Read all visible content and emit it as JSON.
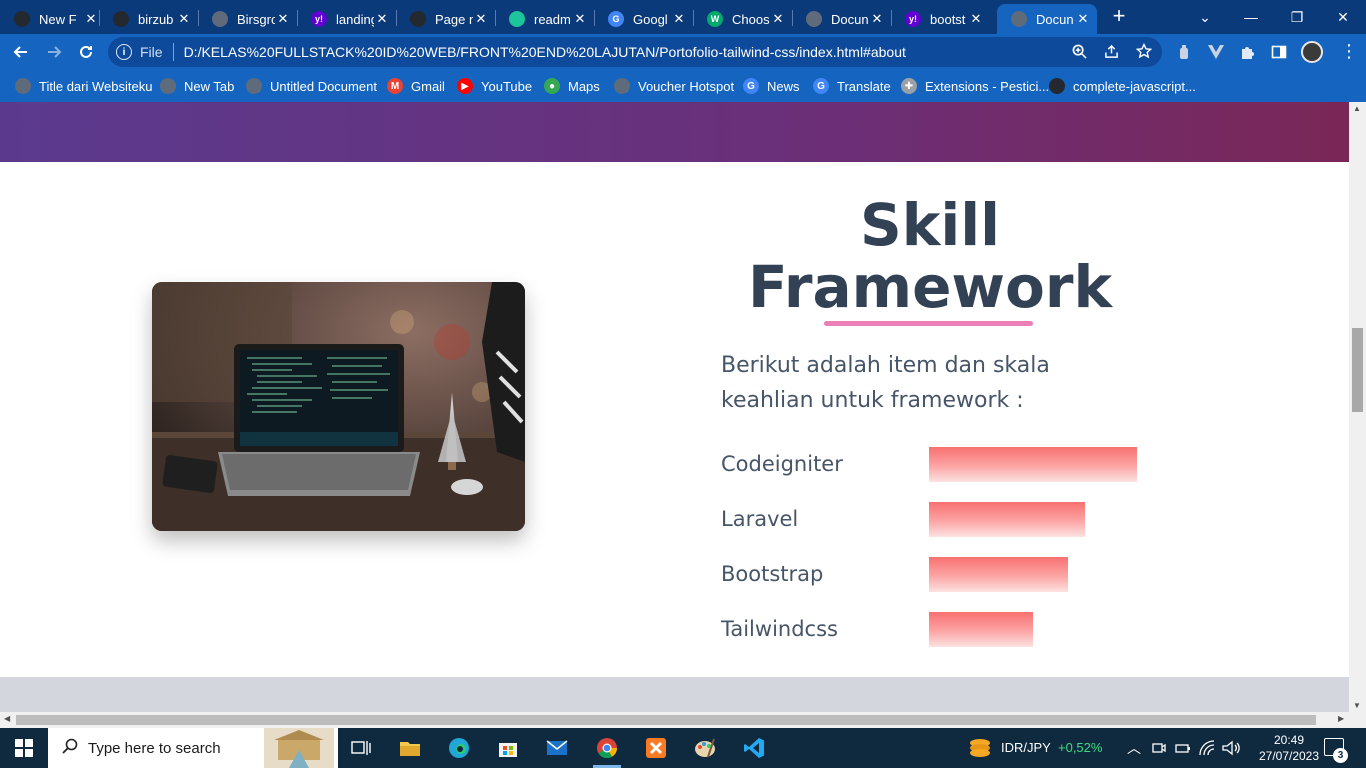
{
  "browser": {
    "tabs": [
      {
        "title": "New Fi",
        "icon": "github-icon",
        "color": "#24292f"
      },
      {
        "title": "birzub",
        "icon": "github-icon",
        "color": "#24292f"
      },
      {
        "title": "Birsgro",
        "icon": "globe-icon",
        "color": "#5f6b7a"
      },
      {
        "title": "landing",
        "icon": "yahoo-icon",
        "color": "#6001d2",
        "glyph": "y!"
      },
      {
        "title": "Page n",
        "icon": "github-icon",
        "color": "#24292f"
      },
      {
        "title": "readm",
        "icon": "readme-icon",
        "color": "#1ec49a"
      },
      {
        "title": "Googl",
        "icon": "google-translate-icon",
        "color": "#4285f4",
        "glyph": "G"
      },
      {
        "title": "Choos",
        "icon": "w3-icon",
        "color": "#04aa6d",
        "glyph": "W"
      },
      {
        "title": "Docun",
        "icon": "globe-icon",
        "color": "#5f6b7a"
      },
      {
        "title": "bootst",
        "icon": "yahoo-icon",
        "color": "#6001d2",
        "glyph": "y!"
      },
      {
        "title": "Docun",
        "icon": "globe-icon",
        "color": "#5f6b7a",
        "active": true
      }
    ],
    "close_glyph": "✕",
    "new_tab_glyph": "+",
    "window_controls": {
      "dropdown": "⌄",
      "minimize": "—",
      "restore": "❐",
      "close": "✕"
    },
    "address": {
      "scheme": "File",
      "url": "D:/KELAS%20FULLSTACK%20ID%20WEB/FRONT%20END%20LAJUTAN/Portofolio-tailwind-css/index.html#about"
    },
    "bookmarks": [
      {
        "label": "Title dari Websiteku",
        "icon": "globe-icon",
        "color": "#5f6b7a"
      },
      {
        "label": "New Tab",
        "icon": "globe-icon",
        "color": "#5f6b7a"
      },
      {
        "label": "Untitled Document",
        "icon": "globe-icon",
        "color": "#5f6b7a"
      },
      {
        "label": "Gmail",
        "icon": "gmail-icon",
        "color": "#ea4335",
        "glyph": "M"
      },
      {
        "label": "YouTube",
        "icon": "youtube-icon",
        "color": "#ff0000",
        "glyph": "▶"
      },
      {
        "label": "Maps",
        "icon": "maps-icon",
        "color": "#34a853",
        "glyph": "●"
      },
      {
        "label": "Voucher Hotspot",
        "icon": "globe-icon",
        "color": "#5f6b7a"
      },
      {
        "label": "News",
        "icon": "google-news-icon",
        "color": "#4285f4",
        "glyph": "G"
      },
      {
        "label": "Translate",
        "icon": "google-translate-icon",
        "color": "#4285f4",
        "glyph": "G"
      },
      {
        "label": "Extensions - Pestici...",
        "icon": "puzzle-icon",
        "color": "#9aa0a6",
        "glyph": "✚"
      },
      {
        "label": "complete-javascript...",
        "icon": "github-icon",
        "color": "#24292f"
      }
    ]
  },
  "page": {
    "skill_title_line1": "Skill",
    "skill_title_line2": "Framework",
    "description": "Berikut adalah item dan skala keahlian untuk framework :",
    "skills": [
      {
        "name": "Codeigniter",
        "level": 1.0
      },
      {
        "name": "Laravel",
        "level": 0.75
      },
      {
        "name": "Bootstrap",
        "level": 0.67
      },
      {
        "name": "Tailwindcss",
        "level": 0.5
      }
    ],
    "accent_color": "#ec7fb6",
    "bar_color": "#f87171"
  },
  "taskbar": {
    "search_placeholder": "Type here to search",
    "currency_label": "IDR/JPY",
    "currency_change": "+0,52%",
    "time": "20:49",
    "date": "27/07/2023",
    "notification_count": "3"
  }
}
